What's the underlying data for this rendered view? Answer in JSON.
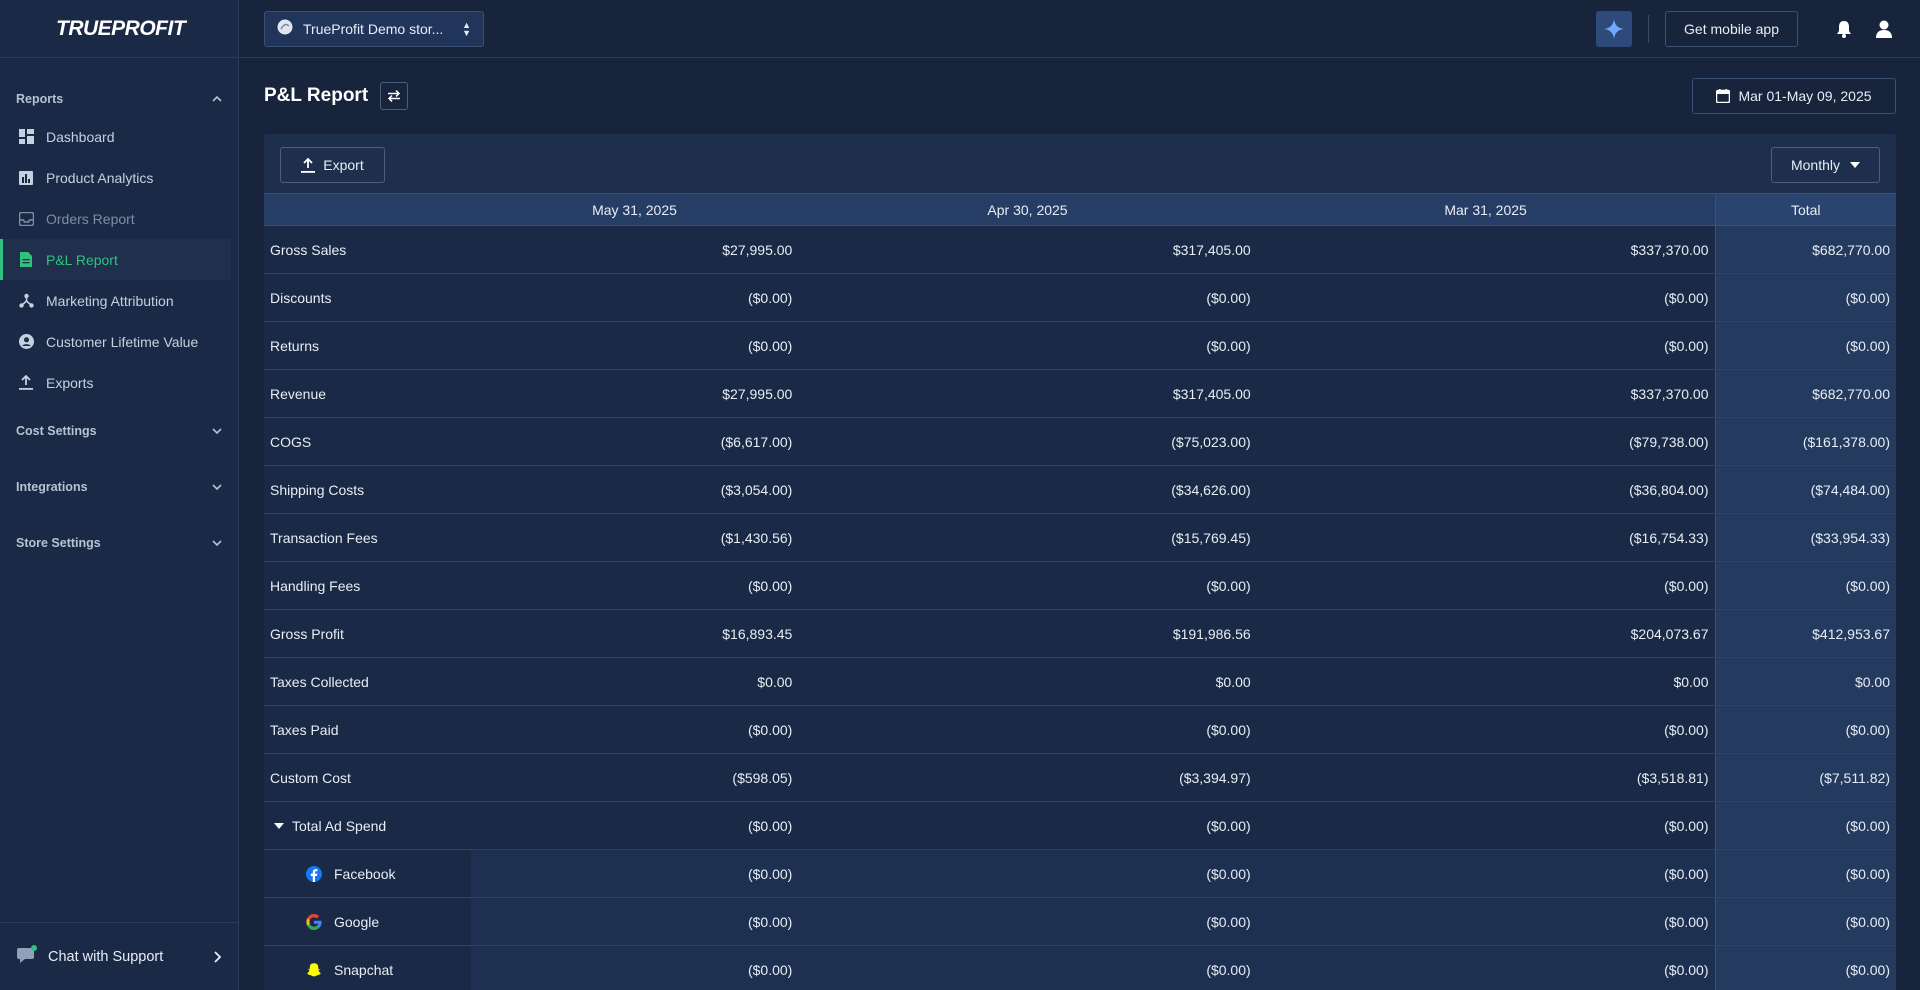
{
  "app": {
    "logo_text": "TRUEPROFIT"
  },
  "sidebar": {
    "sections": {
      "reports": "Reports",
      "cost_settings": "Cost Settings",
      "integrations": "Integrations",
      "store_settings": "Store Settings"
    },
    "items": [
      {
        "label": "Dashboard",
        "icon": "dashboard-icon"
      },
      {
        "label": "Product Analytics",
        "icon": "bar-chart-icon"
      },
      {
        "label": "Orders Report",
        "icon": "inbox-icon"
      },
      {
        "label": "P&L Report",
        "icon": "document-icon"
      },
      {
        "label": "Marketing Attribution",
        "icon": "network-icon"
      },
      {
        "label": "Customer Lifetime Value",
        "icon": "user-circle-icon"
      },
      {
        "label": "Exports",
        "icon": "upload-icon"
      }
    ],
    "chat_label": "Chat with Support"
  },
  "topbar": {
    "store_name": "TrueProfit Demo stor...",
    "mobile_btn": "Get mobile app"
  },
  "page": {
    "title": "P&L Report",
    "date_range": "Mar 01-May 09, 2025",
    "export_label": "Export",
    "period_label": "Monthly"
  },
  "table": {
    "columns": [
      "May 31, 2025",
      "Apr 30, 2025",
      "Mar 31, 2025",
      "Total"
    ],
    "rows": [
      {
        "label": "Gross Sales",
        "values": [
          "$27,995.00",
          "$317,405.00",
          "$337,370.00",
          "$682,770.00"
        ]
      },
      {
        "label": "Discounts",
        "values": [
          "($0.00)",
          "($0.00)",
          "($0.00)",
          "($0.00)"
        ]
      },
      {
        "label": "Returns",
        "values": [
          "($0.00)",
          "($0.00)",
          "($0.00)",
          "($0.00)"
        ]
      },
      {
        "label": "Revenue",
        "values": [
          "$27,995.00",
          "$317,405.00",
          "$337,370.00",
          "$682,770.00"
        ]
      },
      {
        "label": "COGS",
        "values": [
          "($6,617.00)",
          "($75,023.00)",
          "($79,738.00)",
          "($161,378.00)"
        ]
      },
      {
        "label": "Shipping Costs",
        "values": [
          "($3,054.00)",
          "($34,626.00)",
          "($36,804.00)",
          "($74,484.00)"
        ]
      },
      {
        "label": "Transaction Fees",
        "values": [
          "($1,430.56)",
          "($15,769.45)",
          "($16,754.33)",
          "($33,954.33)"
        ]
      },
      {
        "label": "Handling Fees",
        "values": [
          "($0.00)",
          "($0.00)",
          "($0.00)",
          "($0.00)"
        ]
      },
      {
        "label": "Gross Profit",
        "values": [
          "$16,893.45",
          "$191,986.56",
          "$204,073.67",
          "$412,953.67"
        ]
      },
      {
        "label": "Taxes Collected",
        "values": [
          "$0.00",
          "$0.00",
          "$0.00",
          "$0.00"
        ]
      },
      {
        "label": "Taxes Paid",
        "values": [
          "($0.00)",
          "($0.00)",
          "($0.00)",
          "($0.00)"
        ]
      },
      {
        "label": "Custom Cost",
        "values": [
          "($598.05)",
          "($3,394.97)",
          "($3,518.81)",
          "($7,511.82)"
        ]
      },
      {
        "label": "Total Ad Spend",
        "values": [
          "($0.00)",
          "($0.00)",
          "($0.00)",
          "($0.00)"
        ]
      }
    ],
    "ad_rows": [
      {
        "label": "Facebook",
        "icon": "facebook-icon",
        "values": [
          "($0.00)",
          "($0.00)",
          "($0.00)",
          "($0.00)"
        ]
      },
      {
        "label": "Google",
        "icon": "google-icon",
        "values": [
          "($0.00)",
          "($0.00)",
          "($0.00)",
          "($0.00)"
        ]
      },
      {
        "label": "Snapchat",
        "icon": "snapchat-icon",
        "values": [
          "($0.00)",
          "($0.00)",
          "($0.00)",
          "($0.00)"
        ]
      }
    ]
  },
  "colors": {
    "background": "#17243c",
    "sidebar": "#1a2945",
    "accent_green": "#2ec27e",
    "header_row": "#263e66"
  }
}
